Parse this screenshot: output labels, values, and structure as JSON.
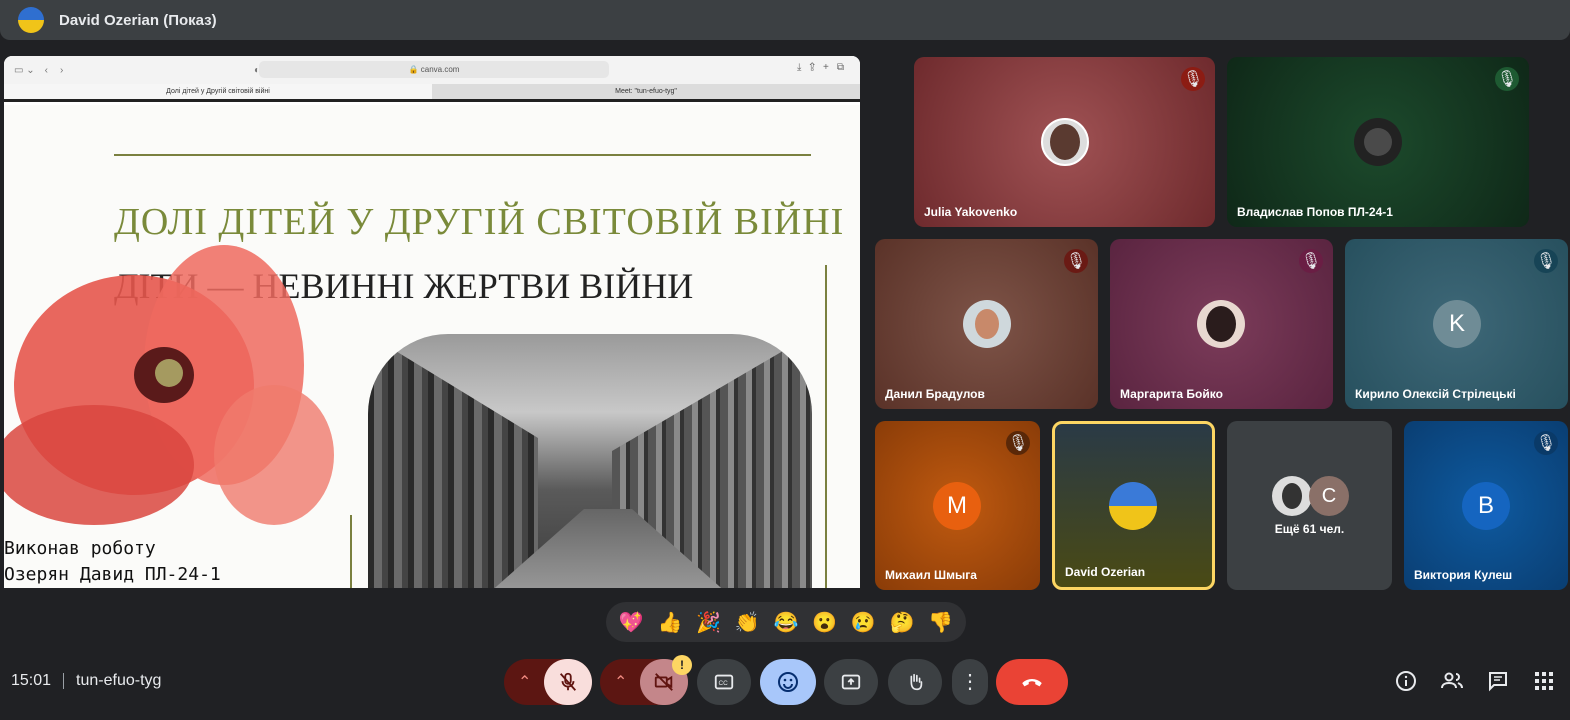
{
  "presenter": {
    "title": "David Ozerian (Показ)"
  },
  "browser": {
    "url": "canva.com",
    "tab1": "Долі дітей у Другій світовій війні",
    "tab2": "Meet: \"tun-efuo-tyg\""
  },
  "slide": {
    "title": "ДОЛІ ДІТЕЙ У ДРУГІЙ СВІТОВІЙ ВІЙНІ",
    "subtitle": "ДІТИ — НЕВИННІ ЖЕРТВИ ВІЙНИ",
    "credit_line1": "Виконав роботу",
    "credit_line2": "Озерян Давид ПЛ-24-1"
  },
  "participants": [
    {
      "name": "Julia Yakovenko",
      "muted": true,
      "color": "#8a3a3c"
    },
    {
      "name": "Владислав Попов ПЛ-24-1",
      "muted": true,
      "color": "#173a22"
    },
    {
      "name": "Данил Брадулов",
      "muted": true,
      "color": "#6b4238"
    },
    {
      "name": "Маргарита Бойко",
      "muted": true,
      "color": "#6a2e4a"
    },
    {
      "name": "Кирило Олексій Стрілецькі",
      "muted": true,
      "color": "#2f5866",
      "initial": "K"
    },
    {
      "name": "Михаил Шмыга",
      "muted": true,
      "color": "#b24d08",
      "initial": "M"
    },
    {
      "name": "David Ozerian",
      "muted": false,
      "color": "#3d4a2a"
    },
    {
      "name": "Виктория Кулеш",
      "muted": true,
      "color": "#0d4a86",
      "initial": "B"
    }
  ],
  "more": {
    "label": "Ещё 61 чел.",
    "initial": "C"
  },
  "reactions": [
    "💖",
    "👍",
    "🎉",
    "👏",
    "😂",
    "😮",
    "😢",
    "🤔",
    "👎"
  ],
  "meeting": {
    "time": "15:01",
    "code": "tun-efuo-tyg"
  },
  "badge": "!"
}
